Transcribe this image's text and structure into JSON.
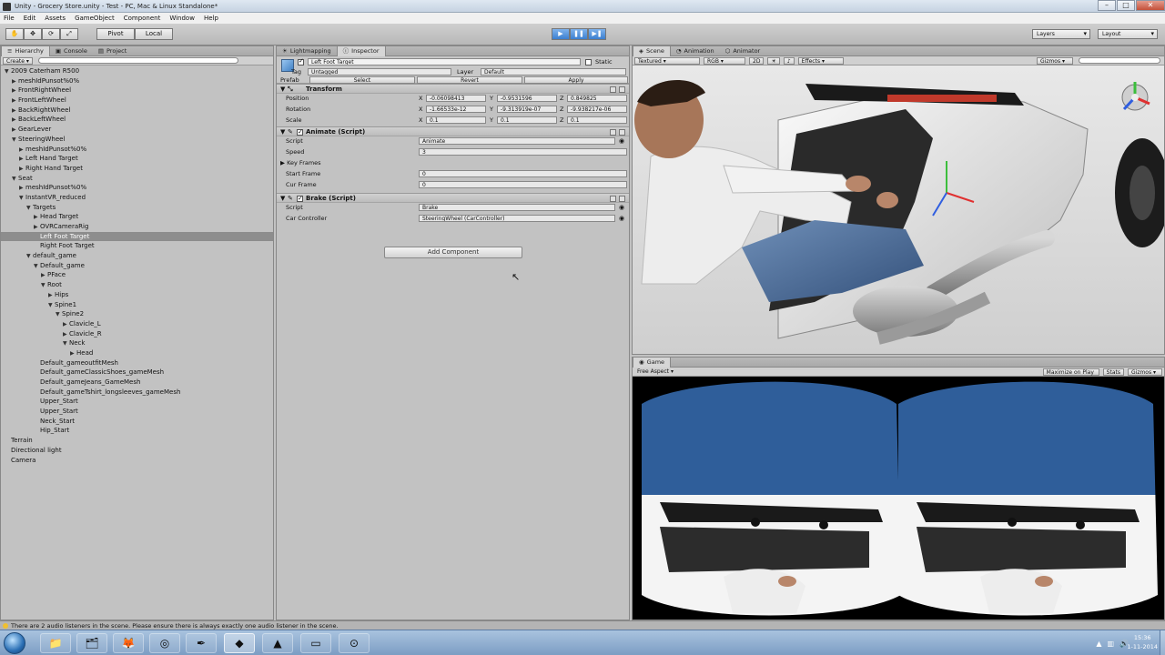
{
  "window": {
    "title": "Unity - Grocery Store.unity - Test - PC, Mac & Linux Standalone*",
    "minimize": "–",
    "maximize": "□",
    "close": "✕"
  },
  "menu": [
    "File",
    "Edit",
    "Assets",
    "GameObject",
    "Component",
    "Window",
    "Help"
  ],
  "toolbar": {
    "pivot_label": "Pivot",
    "local_label": "Local",
    "layers_label": "Layers",
    "layout_label": "Layout"
  },
  "hierarchy": {
    "tabs": [
      "Hierarchy",
      "Console",
      "Project"
    ],
    "create_label": "Create",
    "items": [
      {
        "label": "2009 Caterham R500",
        "depth": 0,
        "arrow": "▼"
      },
      {
        "label": "meshIdPunsot%0%",
        "depth": 1,
        "arrow": "▶"
      },
      {
        "label": "FrontRightWheel",
        "depth": 1,
        "arrow": "▶"
      },
      {
        "label": "FrontLeftWheel",
        "depth": 1,
        "arrow": "▶"
      },
      {
        "label": "BackRightWheel",
        "depth": 1,
        "arrow": "▶"
      },
      {
        "label": "BackLeftWheel",
        "depth": 1,
        "arrow": "▶"
      },
      {
        "label": "GearLever",
        "depth": 1,
        "arrow": "▶"
      },
      {
        "label": "SteeringWheel",
        "depth": 1,
        "arrow": "▼"
      },
      {
        "label": "meshIdPunsot%0%",
        "depth": 2,
        "arrow": "▶"
      },
      {
        "label": "Left Hand Target",
        "depth": 2,
        "arrow": "▶"
      },
      {
        "label": "Right Hand Target",
        "depth": 2,
        "arrow": "▶"
      },
      {
        "label": "Seat",
        "depth": 1,
        "arrow": "▼"
      },
      {
        "label": "meshIdPunsot%0%",
        "depth": 2,
        "arrow": "▶"
      },
      {
        "label": "InstantVR_reduced",
        "depth": 2,
        "arrow": "▼"
      },
      {
        "label": "Targets",
        "depth": 3,
        "arrow": "▼"
      },
      {
        "label": "Head Target",
        "depth": 4,
        "arrow": "▶"
      },
      {
        "label": "OVRCameraRig",
        "depth": 4,
        "arrow": "▶"
      },
      {
        "label": "Left Foot Target",
        "depth": 4,
        "arrow": "",
        "selected": true
      },
      {
        "label": "Right Foot Target",
        "depth": 4,
        "arrow": ""
      },
      {
        "label": "default_game",
        "depth": 3,
        "arrow": "▼"
      },
      {
        "label": "Default_game",
        "depth": 4,
        "arrow": "▼"
      },
      {
        "label": "PFace",
        "depth": 5,
        "arrow": "▶"
      },
      {
        "label": "Root",
        "depth": 5,
        "arrow": "▼"
      },
      {
        "label": "Hips",
        "depth": 6,
        "arrow": "▶"
      },
      {
        "label": "Spine1",
        "depth": 6,
        "arrow": "▼"
      },
      {
        "label": "Spine2",
        "depth": 7,
        "arrow": "▼"
      },
      {
        "label": "Clavicle_L",
        "depth": 8,
        "arrow": "▶"
      },
      {
        "label": "Clavicle_R",
        "depth": 8,
        "arrow": "▶"
      },
      {
        "label": "Neck",
        "depth": 8,
        "arrow": "▼"
      },
      {
        "label": "Head",
        "depth": 9,
        "arrow": "▶"
      },
      {
        "label": "Default_gameoutfitMesh",
        "depth": 4,
        "arrow": ""
      },
      {
        "label": "Default_gameClassicShoes_gameMesh",
        "depth": 4,
        "arrow": ""
      },
      {
        "label": "Default_gameJeans_GameMesh",
        "depth": 4,
        "arrow": ""
      },
      {
        "label": "Default_gameTshirt_longsleeves_gameMesh",
        "depth": 4,
        "arrow": ""
      },
      {
        "label": "Upper_Start",
        "depth": 4,
        "arrow": ""
      },
      {
        "label": "Upper_Start",
        "depth": 4,
        "arrow": ""
      },
      {
        "label": "Neck_Start",
        "depth": 4,
        "arrow": ""
      },
      {
        "label": "Hip_Start",
        "depth": 4,
        "arrow": ""
      },
      {
        "label": "Terrain",
        "depth": 0,
        "arrow": ""
      },
      {
        "label": "Directional light",
        "depth": 0,
        "arrow": ""
      },
      {
        "label": "Camera",
        "depth": 0,
        "arrow": ""
      }
    ]
  },
  "inspector": {
    "tabs": [
      "Lightmapping",
      "Inspector"
    ],
    "object_name": "Left Foot Target",
    "static_label": "Static",
    "tag_label": "Tag",
    "tag_value": "Untagged",
    "layer_label": "Layer",
    "layer_value": "Default",
    "prefab_label": "Prefab",
    "prefab_select": "Select",
    "prefab_revert": "Revert",
    "prefab_apply": "Apply",
    "transform": {
      "title": "Transform",
      "position_label": "Position",
      "rotation_label": "Rotation",
      "scale_label": "Scale",
      "position": [
        "-0.06098413",
        "-0.9531596",
        "0.849825"
      ],
      "rotation": [
        "-1.66533e-12",
        "-9.313919e-07",
        "-9.938217e-06"
      ],
      "scale": [
        "0.1",
        "0.1",
        "0.1"
      ]
    },
    "animate": {
      "title": "Animate (Script)",
      "script_label": "Script",
      "script_value": "Animate",
      "speed_label": "Speed",
      "speed_value": "3",
      "keyframes_label": "Key Frames",
      "start_frame_label": "Start Frame",
      "start_frame_value": "0",
      "cur_frame_label": "Cur Frame",
      "cur_frame_value": "0"
    },
    "brake": {
      "title": "Brake (Script)",
      "script_label": "Script",
      "script_value": "Brake",
      "car_controller_label": "Car Controller",
      "car_controller_value": "SteeringWheel (CarController)"
    },
    "add_component_label": "Add Component"
  },
  "scene": {
    "tabs": [
      "Scene",
      "Animation",
      "Animator"
    ],
    "textured_label": "Textured",
    "rgb_label": "RGB",
    "mode_2d": "2D",
    "effects_label": "Effects",
    "gizmos_label": "Gizmos"
  },
  "game": {
    "tab_label": "Game",
    "aspect_label": "Free Aspect",
    "maximize_label": "Maximize on Play",
    "stats_label": "Stats",
    "gizmos_label": "Gizmos"
  },
  "status": {
    "message": "There are 2 audio listeners in the scene. Please ensure there is always exactly one audio listener in the scene."
  },
  "taskbar": {
    "clock_time": "15:36",
    "clock_date": "1-11-2014",
    "icons": [
      "folder-icon",
      "firefox-icon",
      "blender-icon",
      "gimp-icon",
      "unity-icon",
      "brackets-icon",
      "screen-icon",
      "capture-icon"
    ]
  },
  "colors": {
    "editor_gray": "#c2c2c2",
    "selection": "#8d8d8d",
    "sky_blue": "#2f5e9a",
    "play_blue": "#3b7fd0"
  }
}
